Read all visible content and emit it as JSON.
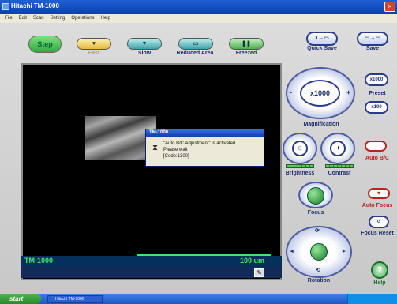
{
  "window": {
    "title": "Hitachi TM-1000",
    "close_glyph": "×"
  },
  "menu": [
    "File",
    "Edit",
    "Scan",
    "Setting",
    "Operations",
    "Help"
  ],
  "toolbar": {
    "step": "Step",
    "fast": "Fast",
    "slow": "Slow",
    "reduced_area": "Reduced Area",
    "freezed": "Freezed",
    "quick_save": "Quick Save",
    "save": "Save",
    "quick_save_icon": "1→▭",
    "save_icon": "▭→▭"
  },
  "viewer": {
    "model": "TM-1000",
    "scale": "100 um"
  },
  "dialog": {
    "title": "TM-1000",
    "line1": "\"Auto B/C Adjustment\" is activated.",
    "line2": "Please wait",
    "line3": "[Code:1300]"
  },
  "controls": {
    "magnification_value": "x1000",
    "magnification": "Magnification",
    "preset_top": "x1000",
    "preset": "Preset",
    "preset_bottom": "x100",
    "brightness": "Brightness",
    "contrast": "Contrast",
    "auto_bc": "Auto B/C",
    "focus": "Focus",
    "auto_focus": "Auto Focus",
    "focus_reset": "Focus Reset",
    "rotation": "Rotation",
    "help": "Help",
    "help_glyph": "?",
    "minus": "-",
    "plus": "+"
  },
  "taskbar": {
    "start": "start",
    "task": "Hitachi TM-1000"
  },
  "colors": {
    "accent": "#1d2c6a",
    "status_green": "#3fe66a",
    "warning_red": "#b8231e"
  }
}
